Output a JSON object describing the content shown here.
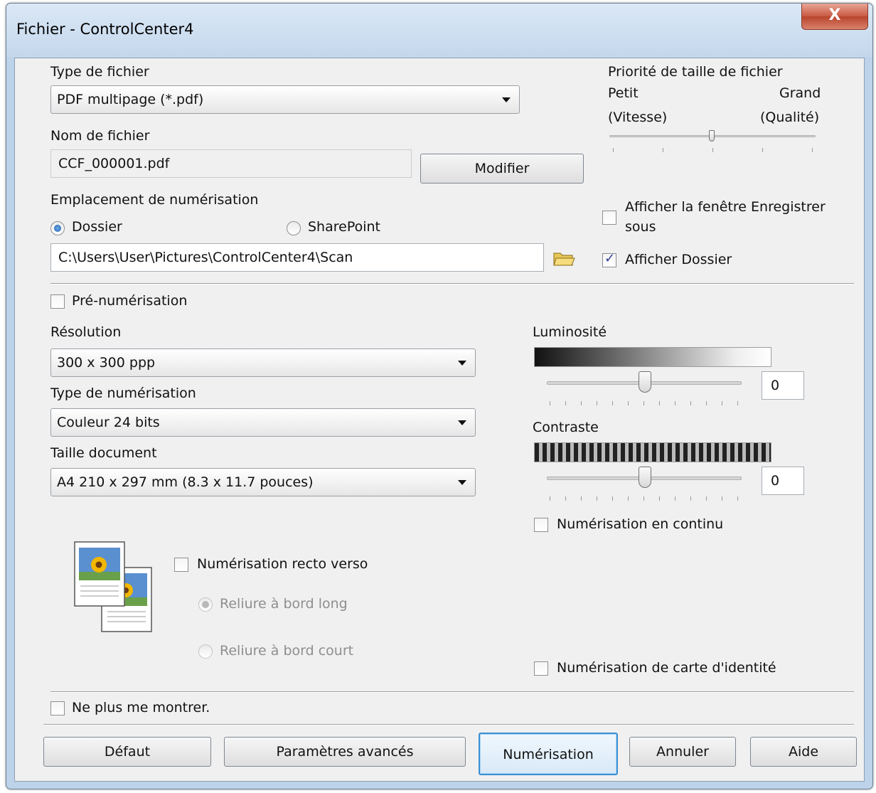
{
  "window": {
    "title": "Fichier - ControlCenter4",
    "close_label": "X"
  },
  "file_type": {
    "label": "Type de fichier",
    "value": "PDF multipage (*.pdf)"
  },
  "file_size": {
    "label": "Priorité de taille de fichier",
    "small_label": "Petit",
    "small_sub": "(Vitesse)",
    "large_label": "Grand",
    "large_sub": "(Qualité)"
  },
  "file_name": {
    "label": "Nom de fichier",
    "value": "CCF_000001.pdf",
    "modify_button": "Modifier"
  },
  "scan_location": {
    "label": "Emplacement de numérisation",
    "option_folder": "Dossier",
    "option_sharepoint": "SharePoint",
    "path": "C:\\Users\\User\\Pictures\\ControlCenter4\\Scan"
  },
  "options_right": {
    "show_save_as_line1": "Afficher la fenêtre Enregistrer",
    "show_save_as_line2": "sous",
    "show_folder": "Afficher Dossier"
  },
  "prescan": {
    "label": "Pré-numérisation"
  },
  "resolution": {
    "label": "Résolution",
    "value": "300 x 300 ppp"
  },
  "scan_type": {
    "label": "Type de numérisation",
    "value": "Couleur 24 bits"
  },
  "doc_size": {
    "label": "Taille document",
    "value": "A4 210 x 297 mm (8.3 x 11.7 pouces)"
  },
  "brightness": {
    "label": "Luminosité",
    "value": "0"
  },
  "contrast": {
    "label": "Contraste",
    "value": "0"
  },
  "continuous_scan": {
    "label": "Numérisation en continu"
  },
  "duplex": {
    "label": "Numérisation recto verso",
    "long_edge": "Reliure à bord long",
    "short_edge": "Reliure à bord court"
  },
  "id_card": {
    "label": "Numérisation de carte d'identité"
  },
  "dont_show": {
    "label": "Ne plus me montrer."
  },
  "buttons": {
    "default": "Défaut",
    "advanced": "Paramètres avancés",
    "scan": "Numérisation",
    "cancel": "Annuler",
    "help": "Aide"
  },
  "colors": {
    "accent": "#3c8fd1",
    "window_frame": "#bcd3ea",
    "client_bg": "#f0f0f0"
  }
}
